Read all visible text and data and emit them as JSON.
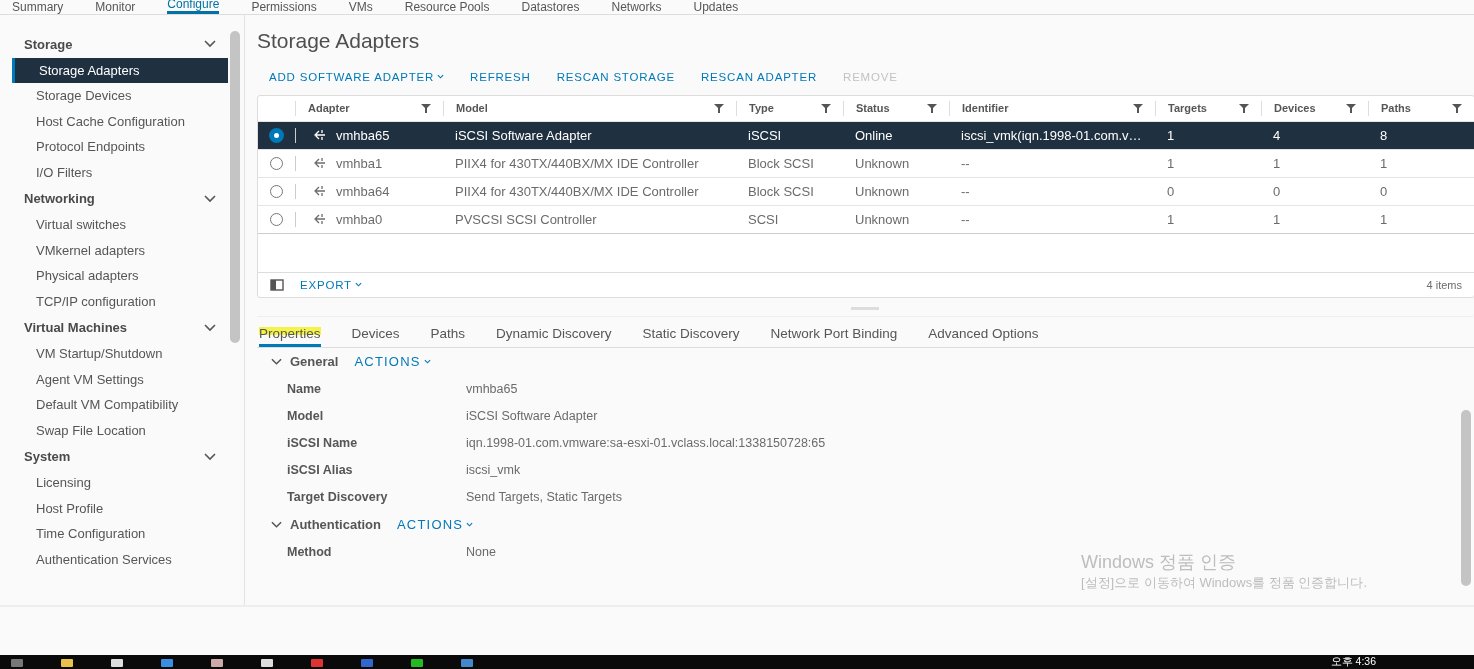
{
  "top_tabs": [
    {
      "label": "Summary",
      "selected": false
    },
    {
      "label": "Monitor",
      "selected": false
    },
    {
      "label": "Configure",
      "selected": true
    },
    {
      "label": "Permissions",
      "selected": false
    },
    {
      "label": "VMs",
      "selected": false
    },
    {
      "label": "Resource Pools",
      "selected": false
    },
    {
      "label": "Datastores",
      "selected": false
    },
    {
      "label": "Networks",
      "selected": false
    },
    {
      "label": "Updates",
      "selected": false
    }
  ],
  "sidebar": {
    "groups": [
      {
        "label": "Storage",
        "expanded": true,
        "items": [
          {
            "label": "Storage Adapters",
            "selected": true
          },
          {
            "label": "Storage Devices",
            "selected": false
          },
          {
            "label": "Host Cache Configuration",
            "selected": false
          },
          {
            "label": "Protocol Endpoints",
            "selected": false
          },
          {
            "label": "I/O Filters",
            "selected": false
          }
        ]
      },
      {
        "label": "Networking",
        "expanded": true,
        "items": [
          {
            "label": "Virtual switches",
            "selected": false
          },
          {
            "label": "VMkernel adapters",
            "selected": false
          },
          {
            "label": "Physical adapters",
            "selected": false
          },
          {
            "label": "TCP/IP configuration",
            "selected": false
          }
        ]
      },
      {
        "label": "Virtual Machines",
        "expanded": true,
        "items": [
          {
            "label": "VM Startup/Shutdown",
            "selected": false
          },
          {
            "label": "Agent VM Settings",
            "selected": false
          },
          {
            "label": "Default VM Compatibility",
            "selected": false
          },
          {
            "label": "Swap File Location",
            "selected": false
          }
        ]
      },
      {
        "label": "System",
        "expanded": true,
        "items": [
          {
            "label": "Licensing",
            "selected": false
          },
          {
            "label": "Host Profile",
            "selected": false
          },
          {
            "label": "Time Configuration",
            "selected": false
          },
          {
            "label": "Authentication Services",
            "selected": false
          }
        ]
      }
    ]
  },
  "page_title": "Storage Adapters",
  "toolbar": [
    {
      "label": "ADD SOFTWARE ADAPTER",
      "has_menu": true,
      "disabled": false
    },
    {
      "label": "REFRESH",
      "has_menu": false,
      "disabled": false
    },
    {
      "label": "RESCAN STORAGE",
      "has_menu": false,
      "disabled": false
    },
    {
      "label": "RESCAN ADAPTER",
      "has_menu": false,
      "disabled": false
    },
    {
      "label": "REMOVE",
      "has_menu": false,
      "disabled": true
    }
  ],
  "table": {
    "columns": [
      "Adapter",
      "Model",
      "Type",
      "Status",
      "Identifier",
      "Targets",
      "Devices",
      "Paths"
    ],
    "rows": [
      {
        "selected": true,
        "cells": [
          "vmhba65",
          "iSCSI Software Adapter",
          "iSCSI",
          "Online",
          "iscsi_vmk(iqn.1998-01.com.v…",
          "1",
          "4",
          "8"
        ]
      },
      {
        "selected": false,
        "cells": [
          "vmhba1",
          "PIIX4 for 430TX/440BX/MX IDE Controller",
          "Block SCSI",
          "Unknown",
          "--",
          "1",
          "1",
          "1"
        ]
      },
      {
        "selected": false,
        "cells": [
          "vmhba64",
          "PIIX4 for 430TX/440BX/MX IDE Controller",
          "Block SCSI",
          "Unknown",
          "--",
          "0",
          "0",
          "0"
        ]
      },
      {
        "selected": false,
        "cells": [
          "vmhba0",
          "PVSCSI SCSI Controller",
          "SCSI",
          "Unknown",
          "--",
          "1",
          "1",
          "1"
        ]
      }
    ],
    "export_label": "EXPORT",
    "item_count": "4 items"
  },
  "detail_tabs": [
    {
      "label": "Properties",
      "selected": true,
      "highlighted": true
    },
    {
      "label": "Devices",
      "selected": false,
      "highlighted": false
    },
    {
      "label": "Paths",
      "selected": false,
      "highlighted": false
    },
    {
      "label": "Dynamic Discovery",
      "selected": false,
      "highlighted": false
    },
    {
      "label": "Static Discovery",
      "selected": false,
      "highlighted": false
    },
    {
      "label": "Network Port Binding",
      "selected": false,
      "highlighted": false
    },
    {
      "label": "Advanced Options",
      "selected": false,
      "highlighted": false
    }
  ],
  "sections": [
    {
      "title": "General",
      "expanded": true,
      "action": "ACTIONS",
      "fields": [
        {
          "label": "Name",
          "value": "vmhba65"
        },
        {
          "label": "Model",
          "value": "iSCSI Software Adapter"
        },
        {
          "label": "iSCSI Name",
          "value": "iqn.1998-01.com.vmware:sa-esxi-01.vclass.local:1338150728:65"
        },
        {
          "label": "iSCSI Alias",
          "value": "iscsi_vmk"
        },
        {
          "label": "Target Discovery",
          "value": "Send Targets, Static Targets"
        }
      ]
    },
    {
      "title": "Authentication",
      "expanded": true,
      "action": "ACTIONS",
      "fields": [
        {
          "label": "Method",
          "value": "None"
        }
      ]
    }
  ],
  "activation": {
    "title": "Windows 정품 인증",
    "message": "[설정]으로 이동하여 Windows를 정품 인증합니다."
  },
  "taskbar": {
    "time": "오후 4:36"
  }
}
